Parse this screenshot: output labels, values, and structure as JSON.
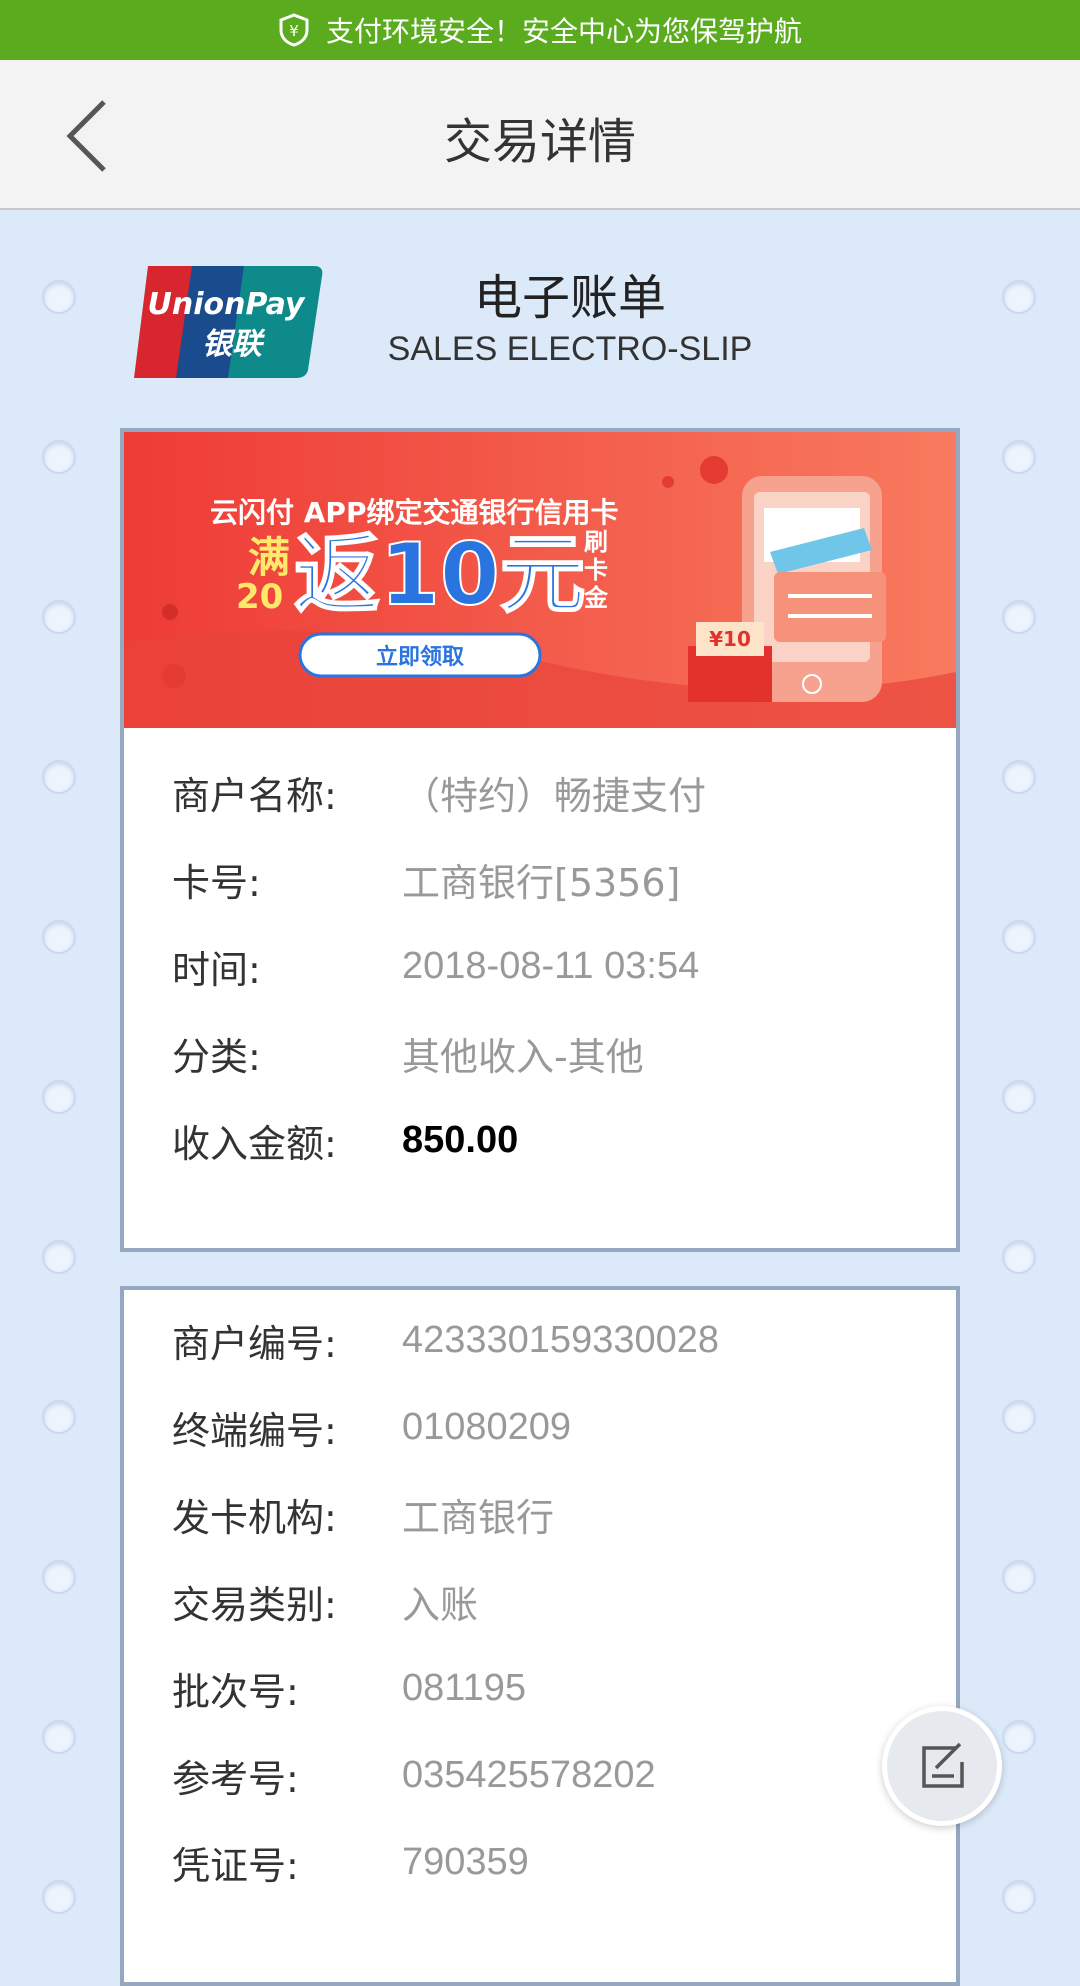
{
  "status_bar": {
    "text": "支付环境安全！安全中心为您保驾护航"
  },
  "header": {
    "title": "交易详情"
  },
  "slip": {
    "title": "电子账单",
    "subtitle": "SALES  ELECTRO-SLIP",
    "logo_text_en": "UnionPay",
    "logo_text_cn": "银联"
  },
  "banner": {
    "line1": "云闪付 APP绑定交通银行信用卡",
    "left_top": "满",
    "left_bottom": "20",
    "big": "返10元",
    "side": [
      "刷",
      "卡",
      "金"
    ],
    "button": "立即领取",
    "envelope": "¥10"
  },
  "details": [
    {
      "label": "商户名称:",
      "value": "（特约）畅捷支付"
    },
    {
      "label": "卡号:",
      "value": "工商银行[5356]"
    },
    {
      "label": "时间:",
      "value": "2018-08-11 03:54"
    },
    {
      "label": "分类:",
      "value": "其他收入-其他"
    },
    {
      "label": "收入金额:",
      "value": "850.00"
    }
  ],
  "details2": [
    {
      "label": "商户编号:",
      "value": "423330159330028"
    },
    {
      "label": "终端编号:",
      "value": "01080209"
    },
    {
      "label": "发卡机构:",
      "value": "工商银行"
    },
    {
      "label": "交易类别:",
      "value": "入账"
    },
    {
      "label": "批次号:",
      "value": "081195"
    },
    {
      "label": "参考号:",
      "value": "035425578202"
    },
    {
      "label": "凭证号:",
      "value": "790359"
    }
  ],
  "colors": {
    "status_green": "#5aac1e",
    "banner_red": "#f05a4c",
    "amount": "#000000"
  }
}
